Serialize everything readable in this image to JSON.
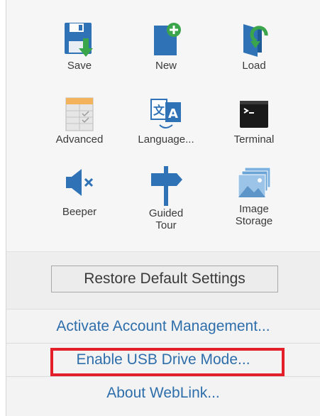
{
  "tiles": [
    {
      "label": "Save",
      "icon": "save-icon"
    },
    {
      "label": "New",
      "icon": "new-document-icon"
    },
    {
      "label": "Load",
      "icon": "load-icon"
    },
    {
      "label": "Advanced",
      "icon": "advanced-table-icon"
    },
    {
      "label": "Language...",
      "icon": "language-icon"
    },
    {
      "label": "Terminal",
      "icon": "terminal-icon"
    },
    {
      "label": "Beeper",
      "icon": "beeper-mute-icon"
    },
    {
      "label": "Guided\nTour",
      "icon": "signpost-icon"
    },
    {
      "label": "Image\nStorage",
      "icon": "image-storage-icon"
    }
  ],
  "restore_label": "Restore Default Settings",
  "links": {
    "activate": "Activate Account Management...",
    "usb": "Enable USB Drive Mode...",
    "about": "About WebLink..."
  },
  "colors": {
    "accent_blue": "#2e6eab",
    "icon_blue": "#2f73b6",
    "icon_green": "#3aa54a",
    "highlight_red": "#e3202a"
  }
}
